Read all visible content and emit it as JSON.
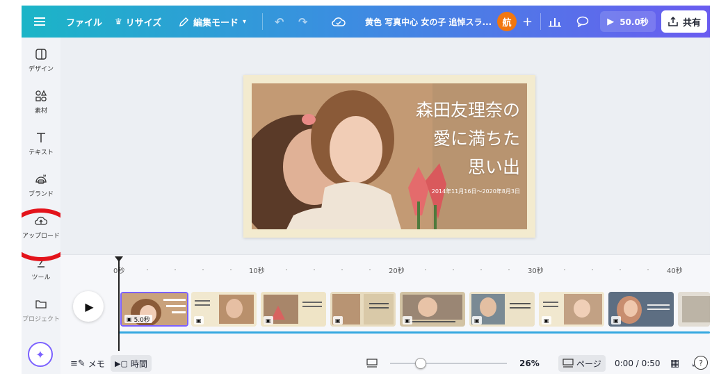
{
  "topbar": {
    "file_label": "ファイル",
    "resize_label": "リサイズ",
    "edit_mode_label": "編集モード",
    "doc_title": "黄色 写真中心 女の子 追悼スラ...",
    "avatar_initial": "航",
    "play_duration": "50.0秒",
    "share_label": "共有"
  },
  "rail": {
    "items": [
      {
        "label": "デザイン",
        "icon": "design-icon"
      },
      {
        "label": "素材",
        "icon": "elements-icon"
      },
      {
        "label": "テキスト",
        "icon": "text-icon"
      },
      {
        "label": "ブランド",
        "icon": "brand-icon"
      },
      {
        "label": "アップロード",
        "icon": "upload-cloud-icon"
      },
      {
        "label": "ツール",
        "icon": "tools-icon"
      },
      {
        "label": "プロジェクト",
        "icon": "folder-icon"
      }
    ]
  },
  "slide": {
    "title": "森田友理奈の\n愛に満ちた\n思い出",
    "dates": "2014年11月16日〜2020年8月3日"
  },
  "timeline": {
    "ruler": [
      "0秒",
      "10秒",
      "20秒",
      "30秒",
      "40秒"
    ],
    "first_clip_duration": "5.0秒",
    "clip_count": 9
  },
  "bottombar": {
    "memo_label": "メモ",
    "time_label": "時間",
    "zoom": "26%",
    "pages_label": "ページ",
    "timecode": "0:00 / 0:50"
  },
  "colors": {
    "accent": "#7b61ff",
    "annotation_ring": "#e3131b",
    "avatar": "#f2770f",
    "track": "#35a8e0"
  }
}
